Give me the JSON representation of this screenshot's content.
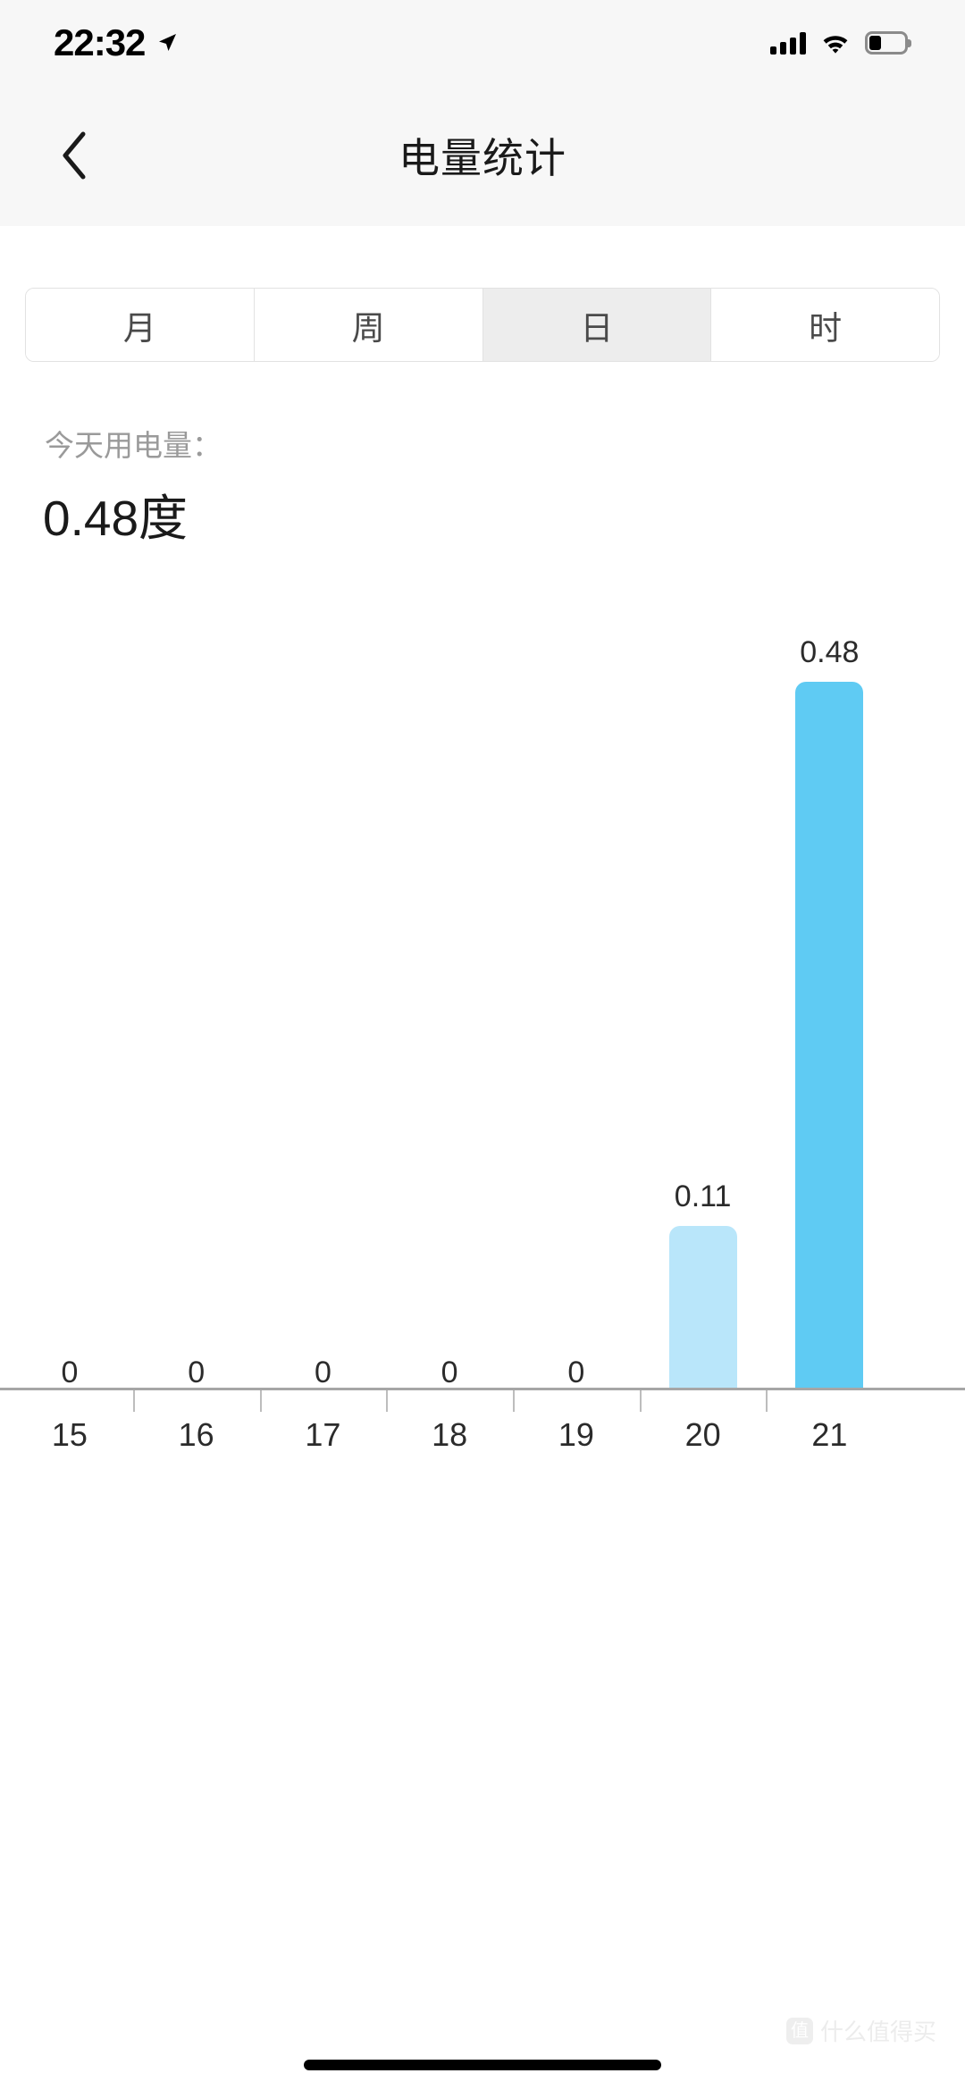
{
  "status_bar": {
    "time": "22:32",
    "location_icon": "location-arrow-icon",
    "signal_icon": "cellular-signal-icon",
    "wifi_icon": "wifi-icon",
    "battery_icon": "battery-low-icon"
  },
  "nav": {
    "back_icon": "back-chevron-icon",
    "title": "电量统计"
  },
  "tabs": [
    {
      "label": "月",
      "selected": false
    },
    {
      "label": "周",
      "selected": false
    },
    {
      "label": "日",
      "selected": true
    },
    {
      "label": "时",
      "selected": false
    }
  ],
  "summary": {
    "label": "今天用电量：",
    "value": "0.48度"
  },
  "watermark": {
    "badge": "值",
    "text": "什么值得买"
  },
  "colors": {
    "bar_highlight": "#5fcbf3",
    "bar_normal": "#b9e6fa",
    "tab_selected_bg": "#ededed",
    "header_bg": "#f7f7f7",
    "axis": "#a6a6a6"
  },
  "chart_data": {
    "type": "bar",
    "title": "",
    "xlabel": "",
    "ylabel": "",
    "unit": "度",
    "categories": [
      "15",
      "16",
      "17",
      "18",
      "19",
      "20",
      "21"
    ],
    "values": [
      0,
      0,
      0,
      0,
      0,
      0.11,
      0.48
    ],
    "value_labels": [
      "0",
      "0",
      "0",
      "0",
      "0",
      "0.11",
      "0.48"
    ],
    "ylim": [
      0,
      0.48
    ],
    "grid": false,
    "legend": false,
    "bar_colors": [
      "#b9e6fa",
      "#b9e6fa",
      "#b9e6fa",
      "#b9e6fa",
      "#b9e6fa",
      "#b9e6fa",
      "#5fcbf3"
    ]
  }
}
